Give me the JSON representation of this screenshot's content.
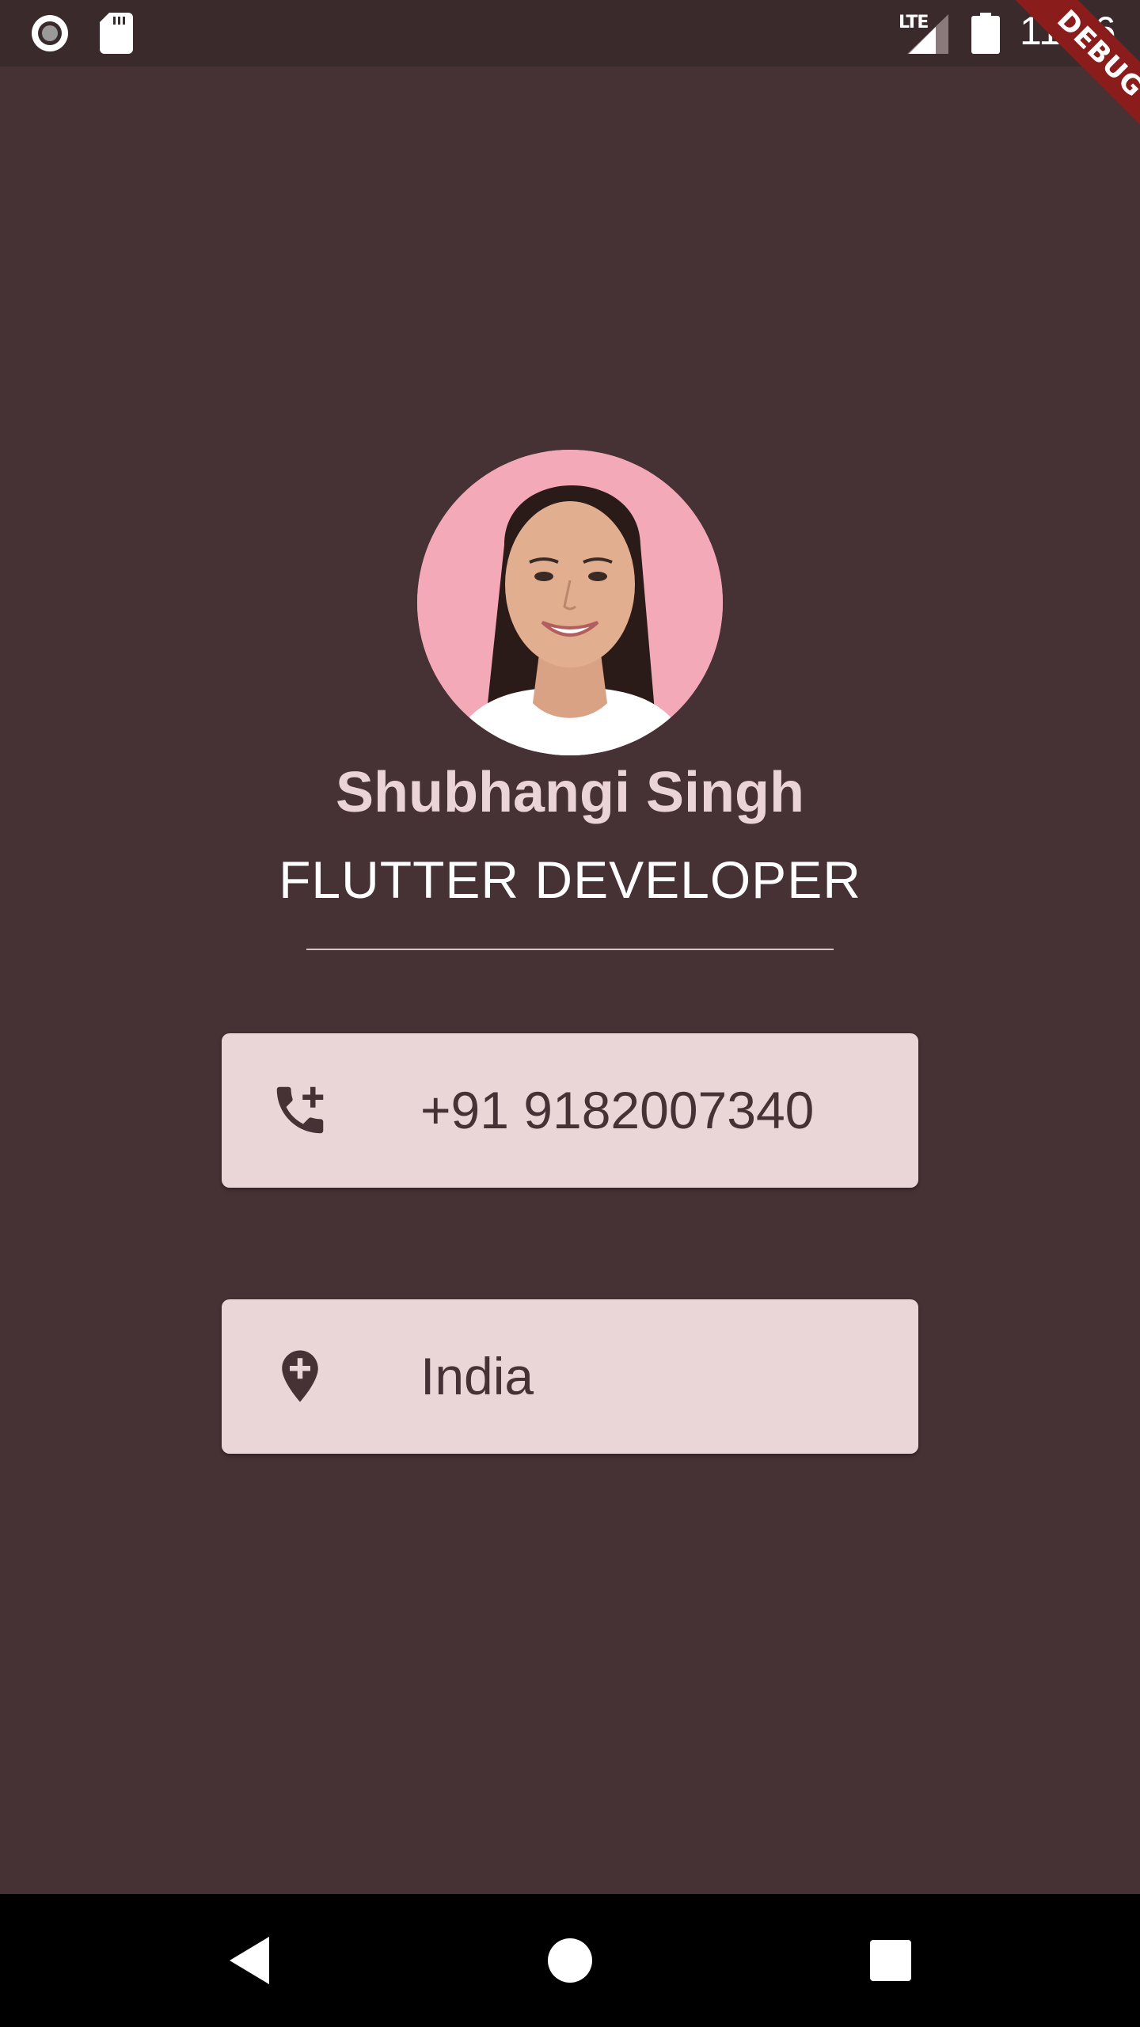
{
  "status_bar": {
    "network_label": "LTE",
    "time": "11:36",
    "icons": [
      "record-icon",
      "sd-card-icon",
      "signal-icon",
      "battery-icon"
    ]
  },
  "debug_banner": "DEBUG",
  "profile": {
    "name": "Shubhangi Singh",
    "title": "FLUTTER DEVELOPER"
  },
  "contacts": [
    {
      "icon": "add-call-icon",
      "label": "+91 9182007340"
    },
    {
      "icon": "add-location-icon",
      "label": "India"
    }
  ],
  "nav_bar": {
    "icons": [
      "back-icon",
      "home-icon",
      "recents-icon"
    ]
  },
  "colors": {
    "background": "#463134",
    "status_bar": "#3a2a2c",
    "name_text": "#ead4d7",
    "card": "#ead5d7",
    "card_text": "#463134",
    "debug_ribbon": "#8a1c1c",
    "avatar_background": "#f4a9b9"
  }
}
